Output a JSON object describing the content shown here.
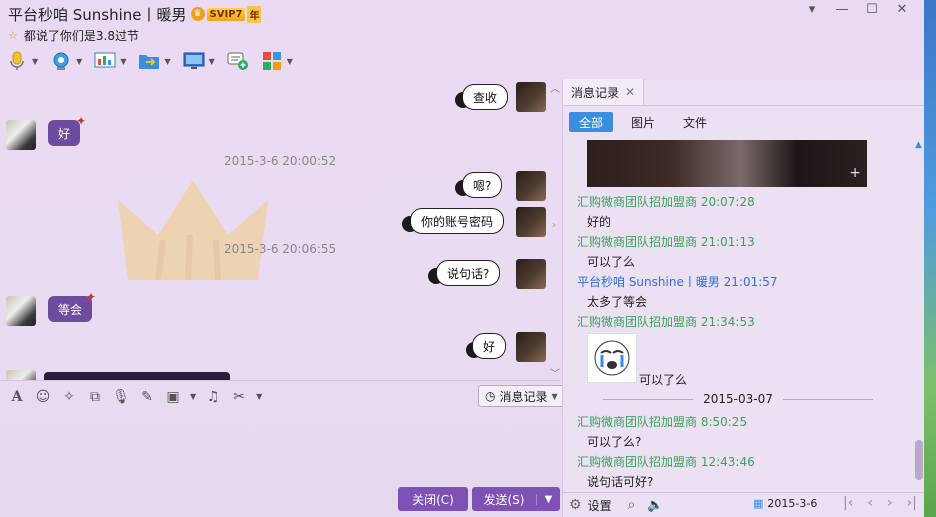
{
  "window": {
    "title": "平台秒咱 Sunshine丨暖男",
    "svip_level": "SVIP7",
    "svip_year": "年",
    "signature": "都说了你们是3.8过节"
  },
  "chat": {
    "messages": [
      {
        "side": "right",
        "text": "查收"
      },
      {
        "side": "left",
        "text": "好"
      },
      {
        "side": "right",
        "text": "嗯?"
      },
      {
        "side": "right",
        "text": "你的账号密码"
      },
      {
        "side": "right",
        "text": "说句话?"
      },
      {
        "side": "left",
        "text": "等会"
      },
      {
        "side": "right",
        "text": "好"
      }
    ],
    "timestamps": [
      "2015-3-6 20:00:52",
      "2015-3-6 20:06:55"
    ]
  },
  "input_toolbar": {
    "history_label": "消息记录"
  },
  "buttons": {
    "close_label": "关闭(C)",
    "send_label": "发送(S)"
  },
  "history_panel": {
    "tab_label": "消息记录",
    "filters": [
      "全部",
      "图片",
      "文件"
    ],
    "entries": [
      {
        "sender": "汇购微商团队招加盟商 20:07:28",
        "text": "好的"
      },
      {
        "sender": "汇购微商团队招加盟商 21:01:13",
        "text": "可以了么"
      },
      {
        "sender": "平台秒咱 Sunshine丨暖男 21:01:57",
        "text": "太多了等会"
      },
      {
        "sender": "汇购微商团队招加盟商 21:34:53",
        "text": "可以了么"
      },
      {
        "sender": "汇购微商团队招加盟商 8:50:25",
        "text": "可以了么?"
      },
      {
        "sender": "汇购微商团队招加盟商 12:43:46",
        "text": "说句话可好?"
      }
    ],
    "date_divider": "2015-03-07",
    "bottom_settings": "设置",
    "bottom_date": "2015-3-6"
  },
  "colors": {
    "accent": "#7e52b5",
    "tab_active": "#3a8ee0",
    "sender_other": "#3aa35a",
    "sender_me": "#2f6fd6"
  }
}
